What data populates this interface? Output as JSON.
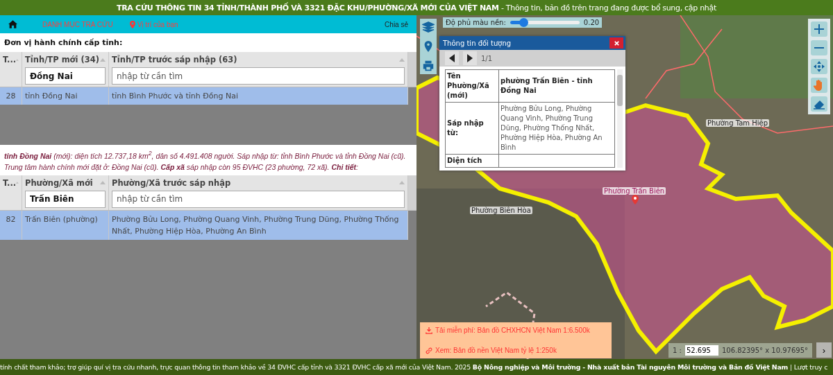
{
  "title_bar": {
    "text": "**TRA CỨU THÔNG TIN 34 TỈNH/THÀNH PHỐ VÀ 3321 ĐẶC KHU/PHƯỜNG/XÃ MỚI CỦA VIỆT NAM** - Thông tin, bản đồ trên trang đang được bổ sung, cập nhật"
  },
  "nav": {
    "items": [
      {
        "label": "DANH MỤC TRA CỨU",
        "kind": "link"
      },
      {
        "label": "Vị trí của bạn",
        "kind": "location"
      }
    ],
    "share": "Chia sẻ"
  },
  "province_section": {
    "heading": "Đơn vị hành chính cấp tỉnh:",
    "table": {
      "columns": [
        "T...",
        "Tỉnh/TP mới (34)",
        "Tỉnh/TP trước sáp nhập (63)"
      ],
      "filters": [
        {
          "value": "Đồng Nai"
        },
        {
          "placeholder": "nhập từ cần tìm"
        }
      ],
      "rows": [
        {
          "cells": [
            "28",
            "tỉnh Đồng Nai",
            "tỉnh Bình Phước và tỉnh Đồng Nai"
          ],
          "selected": true
        }
      ]
    }
  },
  "summary": "**tỉnh Đồng Nai** (mới): diện tích 12.737,18 km$^{2}$, dân số 4.491.408 người. Sáp nhập từ: tỉnh Bình Phước và tỉnh Đồng Nai (cũ). Trung tâm hành chính mới đặt ở: Đồng Nai (cũ). **Cấp xã** sáp nhập còn 95 ĐVHC (23 phường, 72 xã). **Chi tiết**:",
  "ward_section": {
    "table": {
      "columns": [
        "T...",
        "Phường/Xã mới",
        "Phường/Xã trước sáp nhập"
      ],
      "filters": [
        {
          "value": "Trấn Biên"
        },
        {
          "placeholder": "nhập từ cần tìm"
        }
      ],
      "rows": [
        {
          "cells": [
            "82",
            "Trấn Biên (phường)",
            "Phường Bửu Long, Phường Quang Vinh, Phường Trung Dũng, Phường Thống Nhất, Phường Hiệp Hòa, Phường An Bình"
          ],
          "selected": true
        }
      ]
    }
  },
  "map": {
    "opacity_slider": {
      "label": "Độ phủ màu nền:",
      "level": 0.2,
      "reading": "0.20"
    },
    "labels": [
      {
        "text": "Phường Tam Hiệp",
        "kind": "place"
      },
      {
        "text": "Phường Trấn Biên",
        "kind": "selected"
      },
      {
        "text": "Phường Biên Hòa",
        "kind": "place"
      }
    ],
    "popup": {
      "title": "Thông tin đối tượng",
      "page": "1/1",
      "rows": [
        {
          "label": "Tên Phường/Xã (mới)",
          "value": "phường Trấn Biên - tỉnh Đồng Nai",
          "kind": "bold"
        },
        {
          "label": "Sáp nhập từ:",
          "value": "Phường Bửu Long, Phường Quang Vinh, Phường Trung Dũng, Phường Thống Nhất, Phường Hiệp Hòa, Phường An Bình",
          "kind": "plain"
        },
        {
          "label": "Diện tích",
          "kind": "plain"
        }
      ]
    },
    "links": [
      {
        "label": "Tải miễn phí: Bản đồ CHXHCN Việt Nam 1:6.500k",
        "kind": "download"
      },
      {
        "label": "Xem: Bản đồ nền Việt Nam tỷ lệ 1:250k",
        "kind": "view"
      }
    ],
    "scale": {
      "prefix": "1 :",
      "value": "52.695",
      "coordinates": "106.82395° x 10.97695°",
      "next": "›"
    }
  },
  "footer": {
    "text": "tính chất tham khảo; trợ giúp quí vị tra cứu nhanh, trực quan thông tin tham khảo về 34 ĐVHC cấp tỉnh và 3321 ĐVHC cấp xã mới của Việt Nam. 2025  **Bộ Nông nghiệp và Môi trường - Nhà xuất bản Tài nguyên Môi trường và Bản đồ Việt Nam** | Lượt truy c"
  }
}
